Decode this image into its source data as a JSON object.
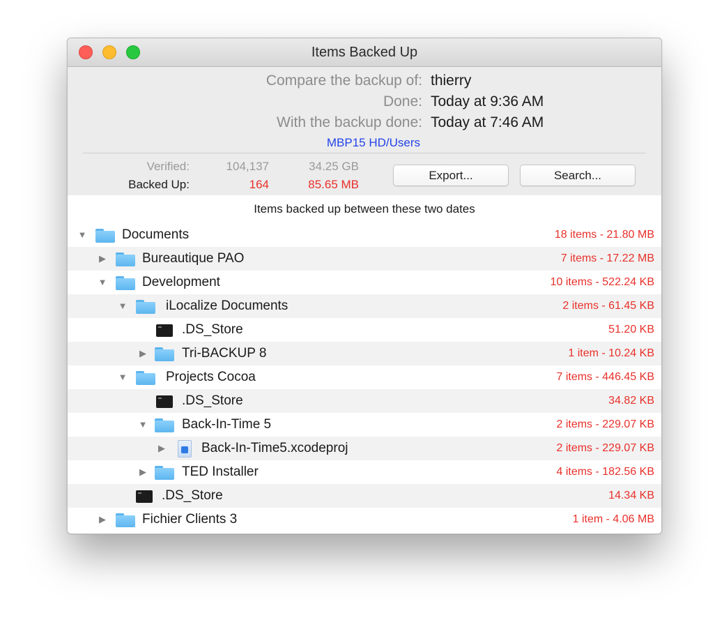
{
  "window": {
    "title": "Items Backed Up"
  },
  "header": {
    "compare_label": "Compare the backup of:",
    "compare_value": "thierry",
    "done_label": "Done:",
    "done_value": "Today at 9:36 AM",
    "with_label": "With the backup done:",
    "with_value": "Today at 7:46 AM",
    "path": "MBP15 HD/Users"
  },
  "stats": {
    "verified_label": "Verified:",
    "verified_count": "104,137",
    "verified_size": "34.25 GB",
    "backed_label": "Backed Up:",
    "backed_count": "164",
    "backed_size": "85.65 MB"
  },
  "buttons": {
    "export": "Export...",
    "search": "Search..."
  },
  "list_caption": "Items backed up between these two dates",
  "tree": [
    {
      "name": "Documents",
      "size": "18 items - 21.80 MB",
      "icon": "folder-icon",
      "expanded": true
    },
    {
      "name": "Bureautique PAO",
      "size": "7 items - 17.22 MB",
      "icon": "folder-icon",
      "expanded": false
    },
    {
      "name": "Development",
      "size": "10 items - 522.24 KB",
      "icon": "folder-icon",
      "expanded": true
    },
    {
      "name": "iLocalize Documents",
      "size": "2 items - 61.45 KB",
      "icon": "folder-icon",
      "expanded": true
    },
    {
      "name": ".DS_Store",
      "size": "51.20 KB",
      "icon": "terminal-file-icon"
    },
    {
      "name": "Tri-BACKUP 8",
      "size": "1 item - 10.24 KB",
      "icon": "folder-icon",
      "expanded": false
    },
    {
      "name": "Projects Cocoa",
      "size": "7 items - 446.45 KB",
      "icon": "folder-icon",
      "expanded": true
    },
    {
      "name": ".DS_Store",
      "size": "34.82 KB",
      "icon": "terminal-file-icon"
    },
    {
      "name": "Back-In-Time 5",
      "size": "2 items - 229.07 KB",
      "icon": "folder-icon",
      "expanded": true
    },
    {
      "name": "Back-In-Time5.xcodeproj",
      "size": "2 items - 229.07 KB",
      "icon": "xcode-project-icon",
      "expanded": false
    },
    {
      "name": "TED Installer",
      "size": "4 items - 182.56 KB",
      "icon": "folder-icon",
      "expanded": false
    },
    {
      "name": ".DS_Store",
      "size": "14.34 KB",
      "icon": "terminal-file-icon"
    },
    {
      "name": "Fichier Clients 3",
      "size": "1 item - 4.06 MB",
      "icon": "folder-icon",
      "expanded": false
    }
  ],
  "colors": {
    "accent_red": "#e8302a",
    "link_blue": "#2343e8",
    "folder_blue": "#6bbdf2"
  }
}
